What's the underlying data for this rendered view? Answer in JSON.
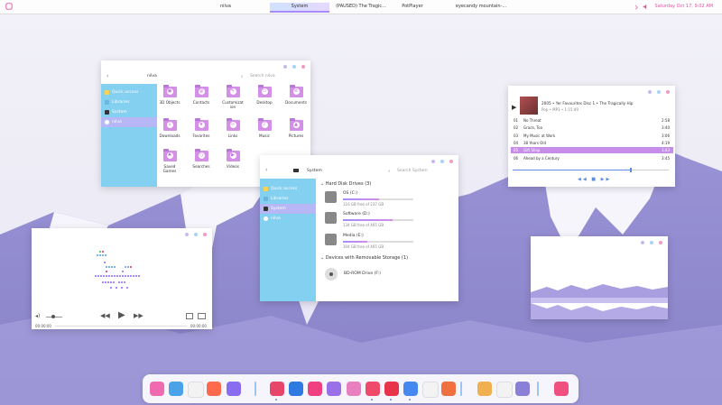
{
  "topbar": {
    "tasks": [
      "nilva",
      "System",
      "(PAUSED) The Tragic...",
      "PotPlayer",
      "eyecandy mountain-..."
    ],
    "active_task": "System",
    "clock": "Saturday Oct 17,     9:02 AM"
  },
  "explorer": {
    "title": "nilva",
    "search_placeholder": "Search nilva",
    "sidebar": [
      "Quick access",
      "Libraries",
      "System",
      "nilva"
    ],
    "folders": [
      {
        "label": "3D Objects",
        "glyph": "▣"
      },
      {
        "label": "Contacts",
        "glyph": "@"
      },
      {
        "label": "Customizat ion",
        "glyph": "✎"
      },
      {
        "label": "Desktop",
        "glyph": "▭"
      },
      {
        "label": "Documents",
        "glyph": "≡"
      },
      {
        "label": "Downloads",
        "glyph": "↓"
      },
      {
        "label": "Favorites",
        "glyph": "★"
      },
      {
        "label": "Links",
        "glyph": "∞"
      },
      {
        "label": "Music",
        "glyph": "♪"
      },
      {
        "label": "Pictures",
        "glyph": "▲"
      },
      {
        "label": "Saved Games",
        "glyph": "♣"
      },
      {
        "label": "Searches",
        "glyph": "○"
      },
      {
        "label": "Videos",
        "glyph": "▶"
      }
    ]
  },
  "system": {
    "title": "System",
    "search_placeholder": "Search System",
    "sidebar": [
      "Quick access",
      "Libraries",
      "System",
      "nilva"
    ],
    "hdd_header": "Hard Disk Drives (3)",
    "drives": [
      {
        "name": "OS (C:)",
        "free": "116 GB free of 237 GB",
        "used_fraction": 0.51
      },
      {
        "name": "Software (D:)",
        "free": "134 GB free of 465 GB",
        "used_fraction": 0.71
      },
      {
        "name": "Media (E:)",
        "free": "304 GB free of 465 GB",
        "used_fraction": 0.35
      }
    ],
    "removable_header": "Devices with Removable Storage (1)",
    "removable": [
      {
        "name": "BD-ROM Drive (F:)"
      }
    ]
  },
  "music": {
    "now_playing": "2005 • Yer Favourites Disc 1 • The Tragically Hip",
    "meta": "Pop • MP3 • 1:15:49",
    "tracks": [
      {
        "num": "01",
        "title": "No Threat",
        "dur": "2:58"
      },
      {
        "num": "02",
        "title": "Grace, Too",
        "dur": "3:40"
      },
      {
        "num": "03",
        "title": "My Music at Work",
        "dur": "3:06"
      },
      {
        "num": "04",
        "title": "38 Years Old",
        "dur": "4:19"
      },
      {
        "num": "05",
        "title": "Gift Shop",
        "dur": "3:43"
      },
      {
        "num": "06",
        "title": "Ahead by a Century",
        "dur": "3:45"
      }
    ],
    "selected_index": 4,
    "progress_fraction": 0.75
  },
  "player": {
    "time_left": "00:00:00",
    "time_right": "00:00:00",
    "volume_fraction": 0.45
  },
  "dock": {
    "apps": [
      "monitor-app-icon",
      "files-app-icon",
      "chrome-app-icon",
      "firefox-app-icon",
      "discord-app-icon",
      "screenshot-app-icon",
      "photoshop-app-icon",
      "editor-app-icon",
      "feather-app-icon",
      "palette-app-icon",
      "steam-app-icon",
      "netflix-app-icon",
      "video-player-app-icon",
      "audio-app-icon",
      "music-app-icon",
      "calendar-app-icon",
      "loader-app-icon",
      "settings-app-icon",
      "trash-app-icon"
    ]
  },
  "colors": {
    "accent": "#a78bfa",
    "sidebar": "#84d0f0",
    "selection": "#c68ee8",
    "clock": "#e056a0"
  }
}
